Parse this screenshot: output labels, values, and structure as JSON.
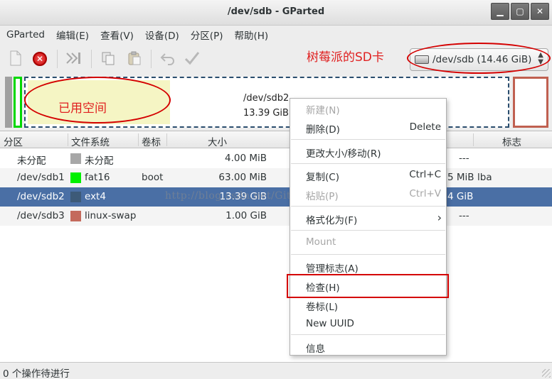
{
  "window": {
    "title": "/dev/sdb - GParted",
    "buttons": [
      "▁",
      "▢",
      "✕"
    ]
  },
  "menubar": [
    "GParted",
    "编辑(E)",
    "查看(V)",
    "设备(D)",
    "分区(P)",
    "帮助(H)"
  ],
  "toolbar": {
    "icons": [
      "new-partition-icon",
      "delete-icon",
      "apply-icon",
      "copy-icon",
      "paste-icon",
      "undo-icon",
      "apply-check-icon"
    ],
    "device_selector": {
      "value": "/dev/sdb  (14.46 GiB)",
      "icon": "disk-icon"
    }
  },
  "annotations": {
    "sd_card": "树莓派的SD卡",
    "used_space": "已用空间"
  },
  "partition_map": {
    "name": "/dev/sdb2",
    "size": "13.39 GiB"
  },
  "table": {
    "headers": [
      "分区",
      "文件系统",
      "卷标",
      "大小",
      "标志"
    ],
    "rows": [
      {
        "partition": "未分配",
        "fs": "未分配",
        "color": "#a7a7a7",
        "label": "",
        "size": "4.00 MiB",
        "tail": "---",
        "flags": ""
      },
      {
        "partition": "/dev/sdb1",
        "fs": "fat16",
        "color": "#00f000",
        "label": "boot",
        "size": "63.00 MiB",
        "tail": "5 MiB",
        "flags": "lba"
      },
      {
        "partition": "/dev/sdb2",
        "fs": "ext4",
        "color": "#3d5a78",
        "label": "",
        "size": "13.39 GiB",
        "tail": "4 GiB",
        "flags": ""
      },
      {
        "partition": "/dev/sdb3",
        "fs": "linux-swap",
        "color": "#c46a5c",
        "label": "",
        "size": "1.00 GiB",
        "tail": "---",
        "flags": ""
      }
    ]
  },
  "watermark": "http://blog.csdn.net/GitChoXingRen",
  "context_menu": {
    "items": [
      {
        "label": "新建(N)",
        "shortcut": "",
        "disabled": true
      },
      {
        "label": "删除(D)",
        "shortcut": "Delete",
        "disabled": false
      },
      {
        "label": "更改大小/移动(R)",
        "shortcut": "",
        "disabled": false
      },
      {
        "label": "复制(C)",
        "shortcut": "Ctrl+C",
        "disabled": false
      },
      {
        "label": "粘贴(P)",
        "shortcut": "Ctrl+V",
        "disabled": true
      },
      {
        "label": "格式化为(F)",
        "shortcut": "",
        "disabled": false,
        "submenu": true
      },
      {
        "label": "Mount",
        "shortcut": "",
        "disabled": true
      },
      {
        "label": "管理标志(A)",
        "shortcut": "",
        "disabled": false
      },
      {
        "label": "检查(H)",
        "shortcut": "",
        "disabled": false
      },
      {
        "label": "卷标(L)",
        "shortcut": "",
        "disabled": false
      },
      {
        "label": "New UUID",
        "shortcut": "",
        "disabled": false
      },
      {
        "label": "信息",
        "shortcut": "",
        "disabled": false
      }
    ]
  },
  "status": "0 个操作待进行"
}
